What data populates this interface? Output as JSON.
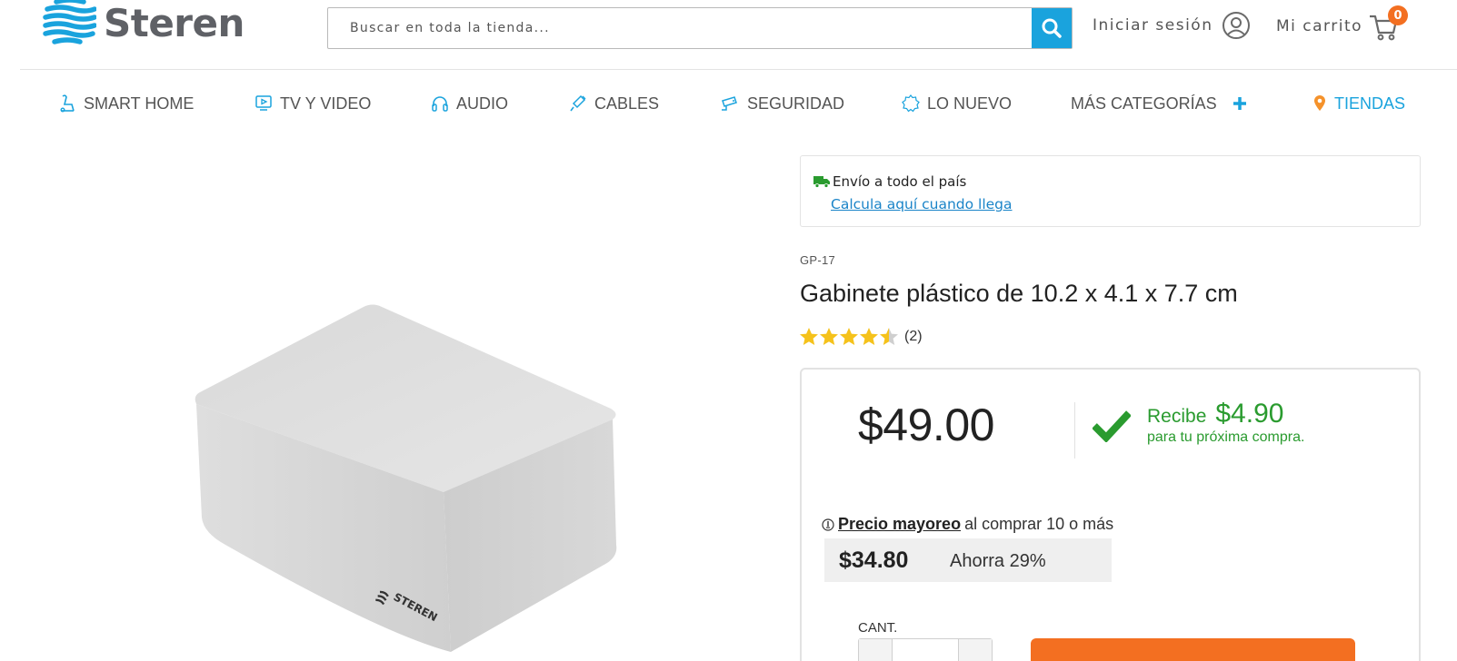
{
  "header": {
    "logo_text": "Steren",
    "search_placeholder": "Buscar en toda la tienda...",
    "login_label": "Iniciar sesión",
    "cart_label": "Mi carrito",
    "cart_count": "0"
  },
  "nav": {
    "items": [
      {
        "label": "SMART HOME",
        "icon": "smart-home-icon"
      },
      {
        "label": "TV Y VIDEO",
        "icon": "tv-icon"
      },
      {
        "label": "AUDIO",
        "icon": "headphones-icon"
      },
      {
        "label": "CABLES",
        "icon": "cable-icon"
      },
      {
        "label": "SEGURIDAD",
        "icon": "security-camera-icon"
      },
      {
        "label": "LO NUEVO",
        "icon": "new-badge-icon"
      },
      {
        "label": "MÁS CATEGORÍAS",
        "icon": "plus-icon"
      },
      {
        "label": "TIENDAS",
        "icon": "location-pin-icon"
      }
    ]
  },
  "shipping": {
    "text": "Envío a todo el país",
    "link": "Calcula aquí cuando llega"
  },
  "product": {
    "sku": "GP-17",
    "title": "Gabinete plástico de 10.2 x 4.1 x 7.7 cm",
    "rating": 4.5,
    "rating_count": "(2)",
    "image_brand": "STEREN"
  },
  "pricing": {
    "price": "$49.00",
    "reward_label": "Recibe",
    "reward_amount": "$4.90",
    "reward_sub": "para tu próxima compra.",
    "mayoreo_link": "Precio mayoreo",
    "mayoreo_text": "al comprar 10 o más",
    "mayoreo_price": "$34.80",
    "mayoreo_save": "Ahorra 29%",
    "qty_label": "CANT."
  },
  "colors": {
    "brand_blue": "#1aa3dd",
    "accent_orange": "#f36f21",
    "reward_green": "#2a9b2f",
    "star_yellow": "#f5c21b"
  }
}
